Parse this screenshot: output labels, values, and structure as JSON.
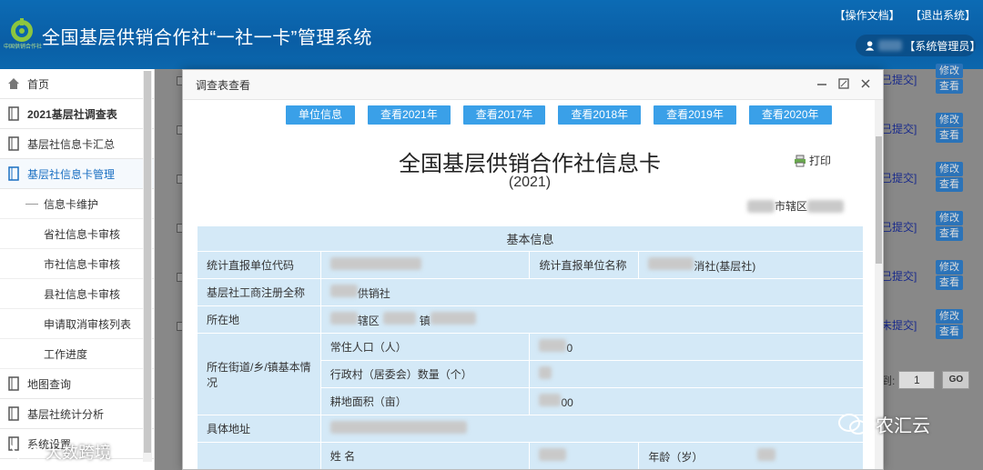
{
  "header": {
    "title": "全国基层供销合作社“一社一卡”管理系统",
    "logo_caption": "中国供销合作社",
    "links": [
      "【操作文档】",
      "【退出系统】"
    ],
    "user_label": "【系统管理员】"
  },
  "sidebar": {
    "items": [
      {
        "label": "首页",
        "icon": "home-icon"
      },
      {
        "label": "2021基层社调查表",
        "icon": "book-icon"
      },
      {
        "label": "基层社信息卡汇总",
        "icon": "book-icon"
      },
      {
        "label": "基层社信息卡管理",
        "icon": "book-icon"
      }
    ],
    "subitems": [
      "信息卡维护",
      "省社信息卡审核",
      "市社信息卡审核",
      "县社信息卡审核",
      "申请取消审核列表",
      "工作进度"
    ],
    "items_after": [
      {
        "label": "地图查询",
        "icon": "book-icon"
      },
      {
        "label": "基层社统计分析",
        "icon": "book-icon"
      },
      {
        "label": "系统设置",
        "icon": "book-icon"
      }
    ]
  },
  "background": {
    "status": [
      "已提交]",
      "已提交]",
      "已提交]",
      "已提交]",
      "已提交]",
      "未提交]"
    ],
    "btn_edit": "修改",
    "btn_view": "查看",
    "pager_label": "到:",
    "pager_value": "1",
    "go_label": "GO"
  },
  "modal": {
    "title": "调查表查看",
    "tabs": [
      "单位信息",
      "查看2021年",
      "查看2017年",
      "查看2018年",
      "查看2019年",
      "查看2020年"
    ],
    "card_title": "全国基层供销合作社信息卡",
    "card_year": "(2021)",
    "print_label": "打印",
    "region_suffix": "市辖区",
    "table": {
      "section": "基本信息",
      "code_label": "统计直报单位代码",
      "name_label": "统计直报单位名称",
      "name_value_suffix": "消社(基层社)",
      "reg_label": "基层社工商注册全称",
      "reg_value_suffix": "供销社",
      "loc_label": "所在地",
      "loc_value_mid": "辖区",
      "loc_value_mid2": "镇",
      "basic_label": "所在街道/乡/镇基本情况",
      "pop_label": "常住人口（人）",
      "pop_value_suffix": "0",
      "village_label": "行政村（居委会）数量（个）",
      "land_label": "耕地面积（亩）",
      "land_value_suffix": "00",
      "addr_label": "具体地址",
      "person_name_label": "姓 名",
      "person_age_label": "年龄（岁）"
    }
  },
  "watermarks": {
    "left": "大数跨境",
    "right": "农汇云"
  }
}
